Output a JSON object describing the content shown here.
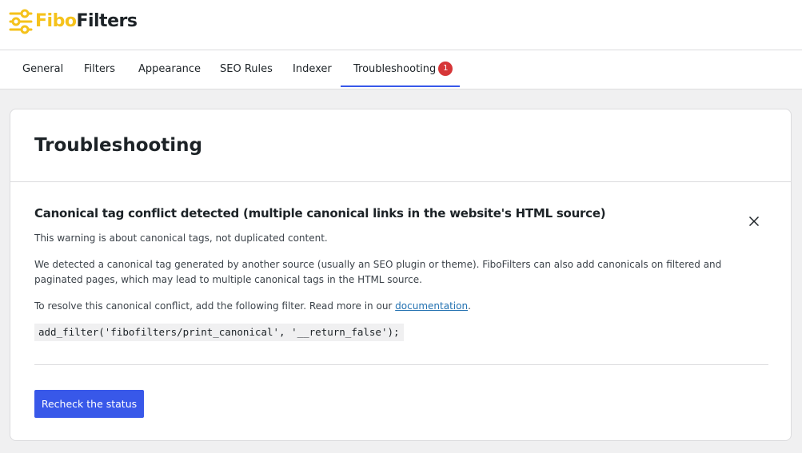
{
  "brand": {
    "name_part1": "Fibo",
    "name_part2": "Filters",
    "logo_icon": "sliders-icon",
    "accent_color": "#f5c21b"
  },
  "tabs": [
    {
      "label": "General",
      "active": false
    },
    {
      "label": "Filters",
      "active": false
    },
    {
      "label": "Appearance",
      "active": false
    },
    {
      "label": "SEO Rules",
      "active": false
    },
    {
      "label": "Indexer",
      "active": false
    },
    {
      "label": "Troubleshooting",
      "active": true,
      "badge": "1"
    }
  ],
  "card": {
    "title": "Troubleshooting",
    "notice": {
      "title": "Canonical tag conflict detected (multiple canonical links in the website's HTML source)",
      "close_icon": "close-icon",
      "paragraph1": "This warning is about canonical tags, not duplicated content.",
      "paragraph2": "We detected a canonical tag generated by another source (usually an SEO plugin or theme). FiboFilters can also add canonicals on filtered and paginated pages, which may lead to multiple canonical tags in the HTML source.",
      "paragraph3_prefix": "To resolve this canonical conflict, add the following filter. Read more in our ",
      "paragraph3_link": "documentation",
      "paragraph3_suffix": ".",
      "code": "add_filter('fibofilters/print_canonical', '__return_false');"
    },
    "button_label": "Recheck the status"
  },
  "colors": {
    "primary": "#3858e9",
    "badge": "#d63638",
    "link": "#2271b1"
  }
}
